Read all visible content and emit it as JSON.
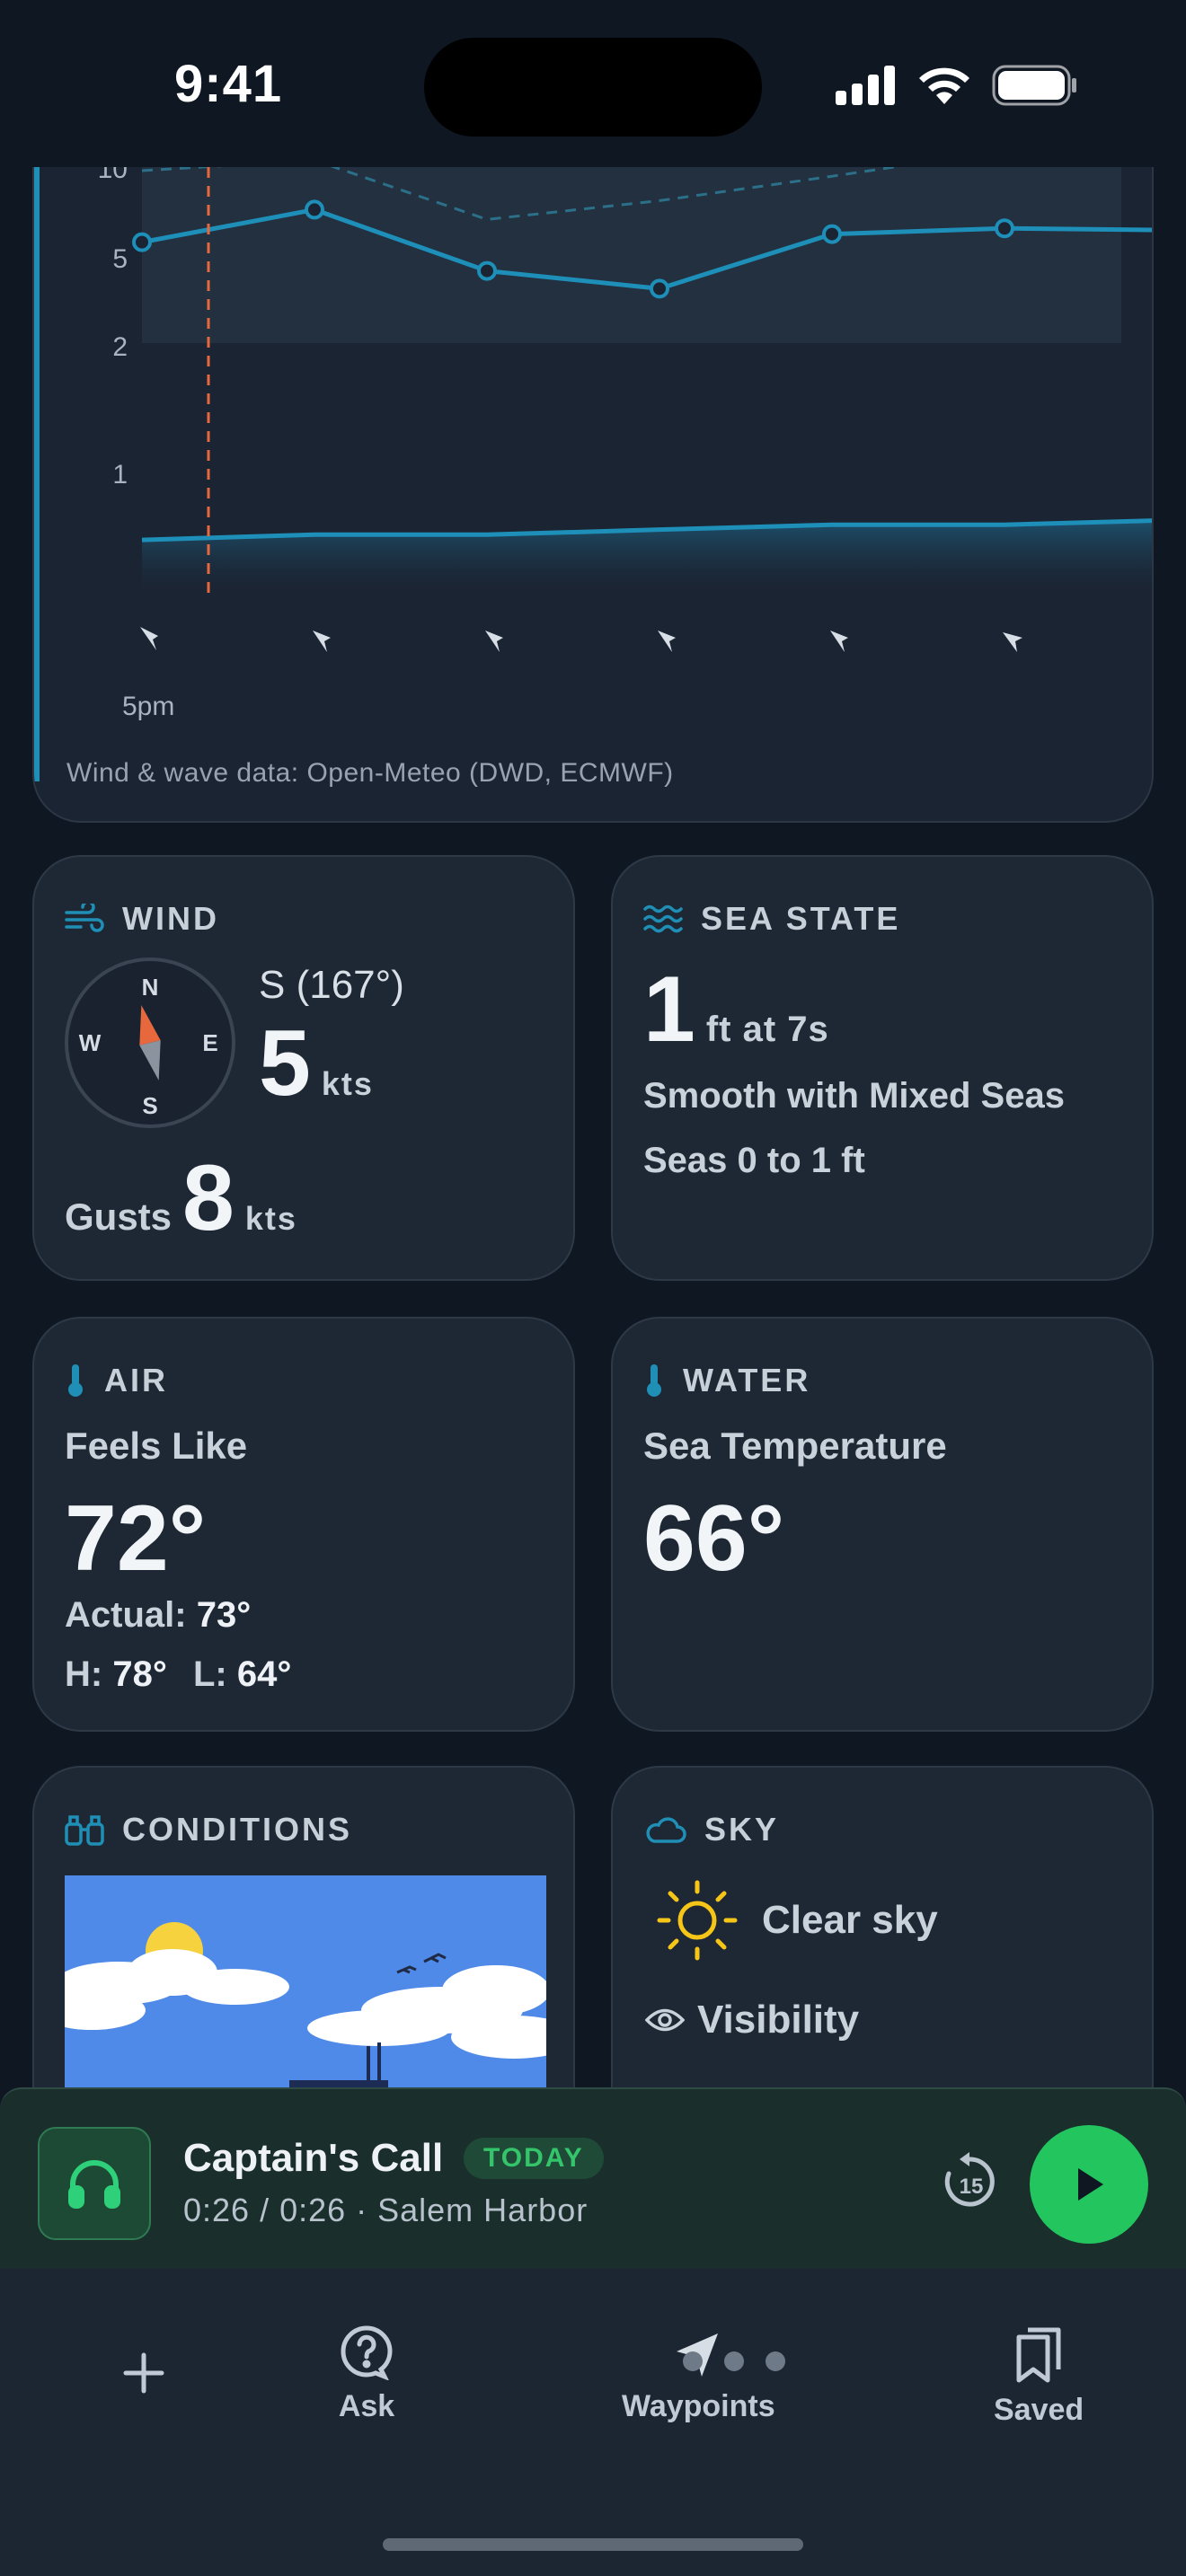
{
  "status": {
    "time": "9:41"
  },
  "chart": {
    "y_ticks": [
      "10",
      "5",
      "2",
      "1"
    ],
    "x_label": "5pm",
    "credit": "Wind & wave data: Open-Meteo (DWD, ECMWF)"
  },
  "chart_data": {
    "type": "line",
    "ylabel": "",
    "yscale": "log",
    "y_ticks": [
      10,
      5,
      2,
      1
    ],
    "x_ticks": [
      "5pm"
    ],
    "series": [
      {
        "values": [
          5.2,
          7.0,
          4.0,
          3.4,
          5.6,
          5.9,
          5.8
        ]
      },
      {
        "values": [
          10,
          11,
          6.4,
          7.6,
          9.5,
          12,
          12
        ]
      },
      {
        "values": [
          0.7,
          0.72,
          0.72,
          0.74,
          0.76,
          0.76,
          0.78
        ]
      }
    ],
    "current_time_marker": true
  },
  "wind": {
    "title": "WIND",
    "compass": {
      "n": "N",
      "e": "E",
      "s": "S",
      "w": "W"
    },
    "direction": "S (167°)",
    "speed": "5",
    "speed_unit": "kts",
    "gusts_label": "Gusts",
    "gusts": "8",
    "gusts_unit": "kts"
  },
  "sea": {
    "title": "SEA STATE",
    "height": "1",
    "height_detail": "ft at 7s",
    "description": "Smooth with Mixed Seas",
    "range": "Seas 0 to 1 ft"
  },
  "air": {
    "title": "AIR",
    "feels_like_label": "Feels Like",
    "feels_like": "72°",
    "actual_label": "Actual:",
    "actual": "73°",
    "high_label": "H:",
    "high": "78°",
    "low_label": "L:",
    "low": "64°"
  },
  "water": {
    "title": "WATER",
    "label": "Sea Temperature",
    "temp": "66°"
  },
  "conditions": {
    "title": "CONDITIONS"
  },
  "sky": {
    "title": "SKY",
    "condition": "Clear sky",
    "visibility_label": "Visibility"
  },
  "player": {
    "title": "Captain's Call",
    "badge": "TODAY",
    "subtitle": "0:26 / 0:26 · Salem Harbor",
    "replay_seconds": "15"
  },
  "tabs": [
    {
      "label": ""
    },
    {
      "label": "Ask"
    },
    {
      "label": "Waypoints"
    },
    {
      "label": "Saved"
    }
  ],
  "colors": {
    "accent": "#1f8fb6",
    "line": "#1d8fb8",
    "marker": "#e8683e",
    "play": "#22c55e",
    "today": "#34c46a"
  }
}
